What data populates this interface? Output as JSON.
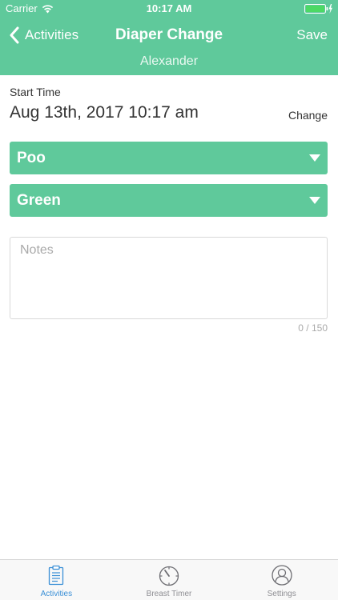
{
  "status_bar": {
    "carrier": "Carrier",
    "time": "10:17 AM"
  },
  "nav": {
    "back_label": "Activities",
    "title": "Diaper Change",
    "save_label": "Save",
    "subtitle": "Alexander"
  },
  "start_time": {
    "label": "Start Time",
    "value": "Aug 13th, 2017 10:17 am",
    "change_label": "Change"
  },
  "dropdowns": [
    {
      "selected": "Poo"
    },
    {
      "selected": "Green"
    }
  ],
  "notes": {
    "placeholder": "Notes",
    "value": "",
    "counter": "0 / 150"
  },
  "tabs": [
    {
      "label": "Activities",
      "icon": "clipboard-icon",
      "active": true
    },
    {
      "label": "Breast Timer",
      "icon": "timer-icon",
      "active": false
    },
    {
      "label": "Settings",
      "icon": "settings-icon",
      "active": false
    }
  ],
  "colors": {
    "brand": "#5fc99b",
    "tab_active": "#3a8fd6",
    "tab_inactive": "#8e8e93",
    "battery": "#4cd964"
  }
}
